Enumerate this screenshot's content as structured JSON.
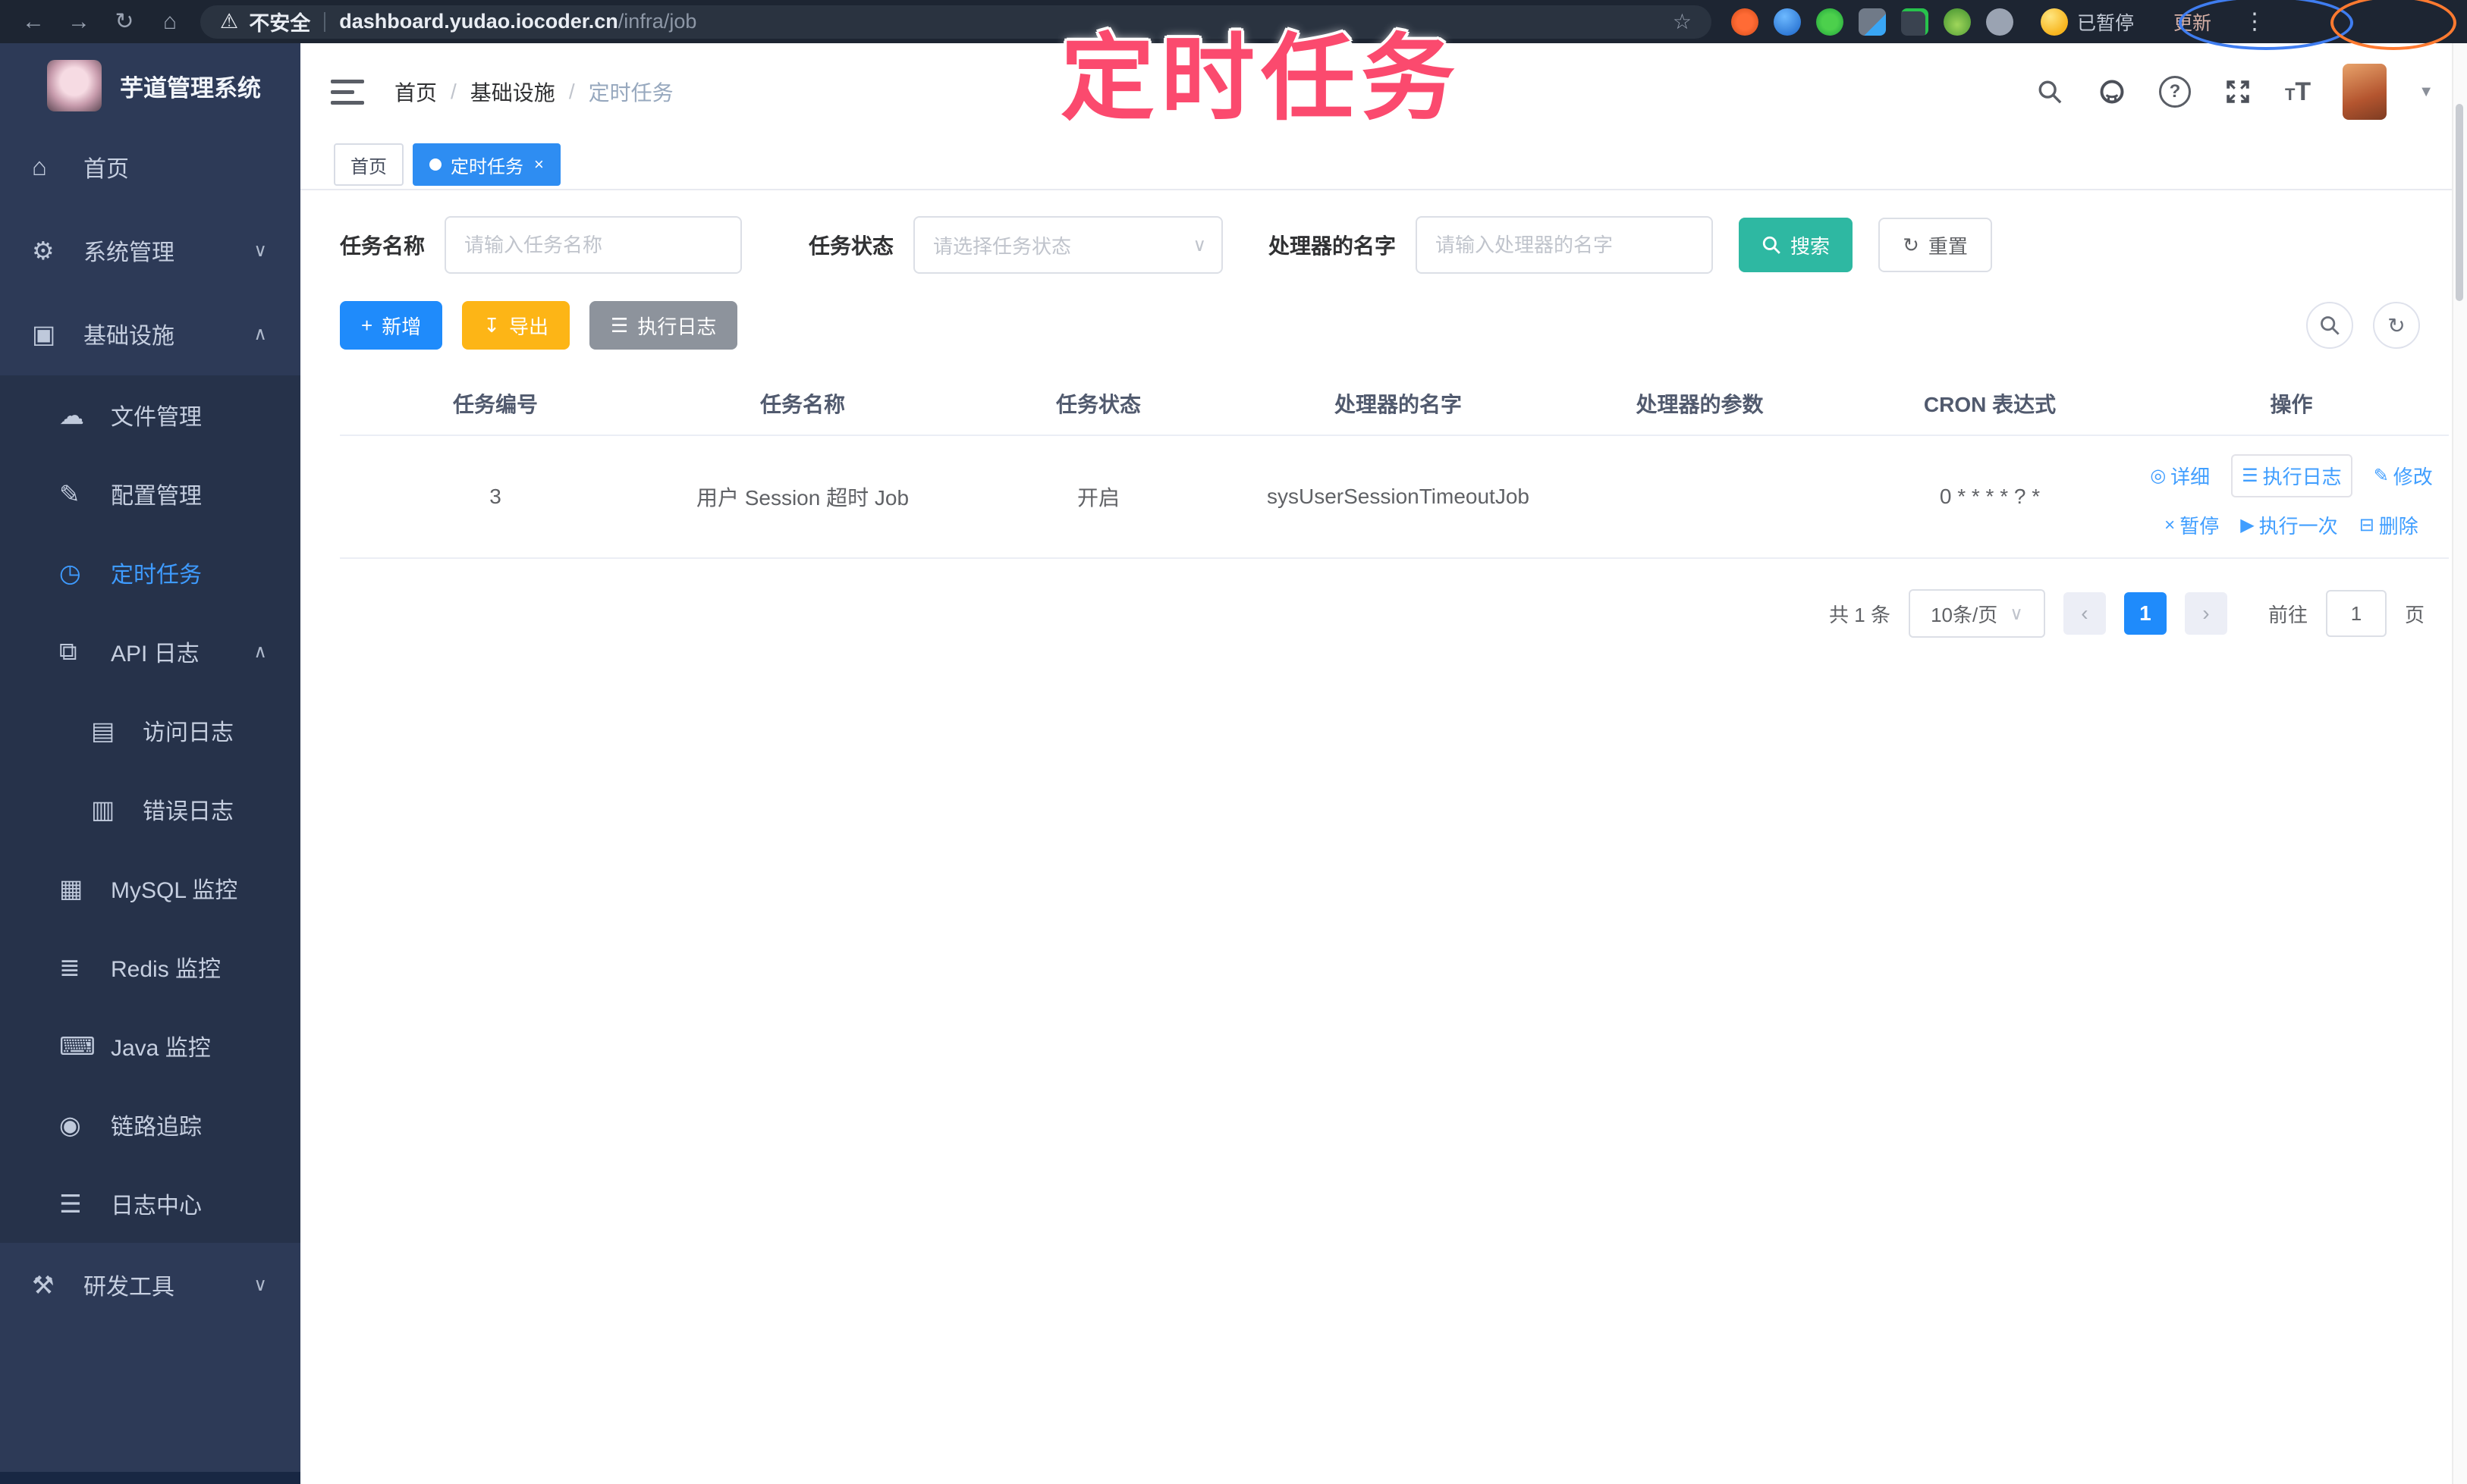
{
  "browser": {
    "security_label": "不安全",
    "url_host": "dashboard.yudao.iocoder.cn",
    "url_path": "/infra/job",
    "paused_badge": "已暂停",
    "update_button": "更新"
  },
  "annotation": {
    "text": "定时任务"
  },
  "sidebar": {
    "app_title": "芋道管理系统",
    "items": [
      {
        "label": "首页",
        "glyph": "⌂"
      },
      {
        "label": "系统管理",
        "glyph": "⚙",
        "chevron": "∨"
      },
      {
        "label": "基础设施",
        "glyph": "▣",
        "chevron": "∧"
      },
      {
        "label": "文件管理",
        "glyph": "☁"
      },
      {
        "label": "配置管理",
        "glyph": "✎"
      },
      {
        "label": "定时任务",
        "glyph": "◷"
      },
      {
        "label": "API 日志",
        "glyph": "⧉",
        "chevron": "∧"
      },
      {
        "label": "访问日志",
        "glyph": "▤"
      },
      {
        "label": "错误日志",
        "glyph": "▥"
      },
      {
        "label": "MySQL 监控",
        "glyph": "▦"
      },
      {
        "label": "Redis 监控",
        "glyph": "≣"
      },
      {
        "label": "Java 监控",
        "glyph": "⌨"
      },
      {
        "label": "链路追踪",
        "glyph": "◉"
      },
      {
        "label": "日志中心",
        "glyph": "☰"
      },
      {
        "label": "研发工具",
        "glyph": "⚒",
        "chevron": "∨"
      }
    ]
  },
  "header": {
    "breadcrumb": [
      "首页",
      "基础设施",
      "定时任务"
    ],
    "separator": "/"
  },
  "tabs": [
    {
      "label": "首页"
    },
    {
      "label": "定时任务",
      "close": "×"
    }
  ],
  "filters": {
    "name_label": "任务名称",
    "name_placeholder": "请输入任务名称",
    "status_label": "任务状态",
    "status_placeholder": "请选择任务状态",
    "handler_label": "处理器的名字",
    "handler_placeholder": "请输入处理器的名字",
    "search_label": "搜索",
    "reset_label": "重置",
    "reset_glyph": "↻"
  },
  "toolbar": {
    "add_label": "新增",
    "add_glyph": "+",
    "export_label": "导出",
    "export_glyph": "↧",
    "exec_log_label": "执行日志",
    "exec_log_glyph": "☰",
    "refresh_glyph": "↻"
  },
  "table": {
    "headers": [
      "任务编号",
      "任务名称",
      "任务状态",
      "处理器的名字",
      "处理器的参数",
      "CRON 表达式",
      "操作"
    ],
    "row": {
      "id": "3",
      "name": "用户 Session 超时 Job",
      "status": "开启",
      "handler": "sysUserSessionTimeoutJob",
      "param": "",
      "cron": "0 * * * * ? *",
      "ops1": [
        {
          "icon": "◎",
          "label": "详细"
        },
        {
          "icon": "☰",
          "label": "执行日志"
        },
        {
          "icon": "✎",
          "label": "修改"
        }
      ],
      "ops2": [
        {
          "icon": "×",
          "label": "暂停"
        },
        {
          "icon": "▶",
          "label": "执行一次"
        },
        {
          "icon": "⊟",
          "label": "删除"
        }
      ]
    }
  },
  "pagination": {
    "total": "共 1 条",
    "page_size": "10条/页",
    "prev": "‹",
    "next": "›",
    "page": "1",
    "goto_label": "前往",
    "goto_value": "1",
    "page_suffix": "页"
  }
}
